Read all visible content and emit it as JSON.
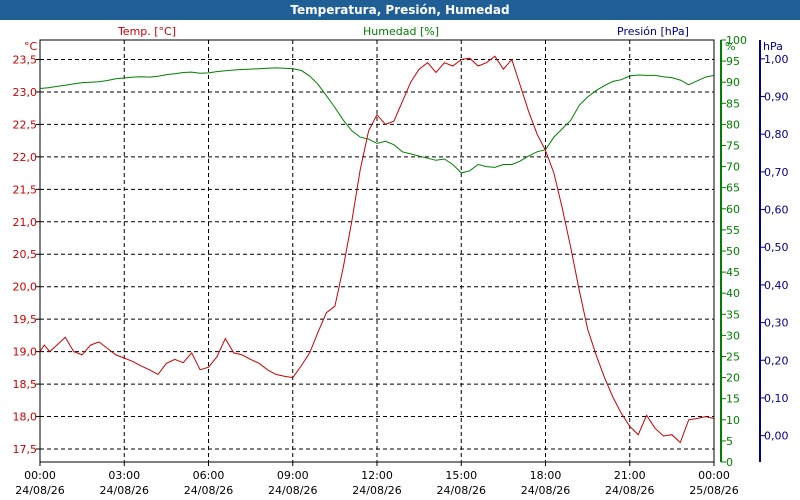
{
  "window": {
    "title": "Temperatura, Presión, Humedad"
  },
  "chart_data": {
    "type": "line",
    "title": "Temperatura, Presión, Humedad",
    "grid": true,
    "x_ticks": [
      {
        "time": "00:00",
        "date": "24/08/26"
      },
      {
        "time": "03:00",
        "date": "24/08/26"
      },
      {
        "time": "06:00",
        "date": "24/08/26"
      },
      {
        "time": "09:00",
        "date": "24/08/26"
      },
      {
        "time": "12:00",
        "date": "24/08/26"
      },
      {
        "time": "15:00",
        "date": "24/08/26"
      },
      {
        "time": "18:00",
        "date": "24/08/26"
      },
      {
        "time": "21:00",
        "date": "24/08/26"
      },
      {
        "time": "00:00",
        "date": "25/08/26"
      }
    ],
    "x_range_hours": [
      0,
      24
    ],
    "axes": {
      "temperature": {
        "label": "Temp. [°C]",
        "unit": "°C",
        "color": "#cc0000",
        "range": [
          17.3,
          23.8
        ],
        "ticks": [
          "17,5",
          "18,0",
          "18,5",
          "19,0",
          "19,5",
          "20,0",
          "20,5",
          "21,0",
          "21,5",
          "22,0",
          "22,5",
          "23,0",
          "23,5"
        ]
      },
      "humidity": {
        "label": "Humedad [%]",
        "unit": "%",
        "color": "#008000",
        "range": [
          0,
          100
        ],
        "ticks": [
          "0",
          "5",
          "10",
          "15",
          "20",
          "25",
          "30",
          "35",
          "40",
          "45",
          "50",
          "55",
          "60",
          "65",
          "70",
          "75",
          "80",
          "85",
          "90",
          "95",
          "100"
        ]
      },
      "pressure": {
        "label": "Presión [hPa]",
        "unit": "hPa",
        "color": "#00008b",
        "range": [
          -0.07,
          1.05
        ],
        "ticks": [
          "0,00",
          "0,10",
          "0,20",
          "0,30",
          "0,40",
          "0,50",
          "0,60",
          "0,70",
          "0,80",
          "0,90",
          "1,00"
        ]
      }
    },
    "series": [
      {
        "name": "Temp. [°C]",
        "axis": "temperature",
        "color": "#cc0000",
        "x": [
          0,
          0.15,
          0.35,
          0.6,
          0.9,
          1.2,
          1.5,
          1.8,
          2.1,
          2.4,
          2.7,
          3,
          3.3,
          3.6,
          3.9,
          4.2,
          4.5,
          4.8,
          5.1,
          5.4,
          5.7,
          6,
          6.3,
          6.6,
          6.9,
          7.2,
          7.5,
          7.8,
          8.1,
          8.4,
          8.7,
          9,
          9.3,
          9.6,
          9.9,
          10.2,
          10.5,
          10.8,
          11.1,
          11.4,
          11.7,
          12,
          12.3,
          12.6,
          12.9,
          13.2,
          13.5,
          13.8,
          14.1,
          14.4,
          14.7,
          15,
          15.3,
          15.6,
          15.9,
          16.2,
          16.5,
          16.8,
          17.1,
          17.4,
          17.7,
          18,
          18.3,
          18.6,
          18.9,
          19.2,
          19.5,
          19.8,
          20.1,
          20.4,
          20.7,
          21,
          21.3,
          21.6,
          21.9,
          22.2,
          22.5,
          22.8,
          23.1,
          23.4,
          23.7,
          24
        ],
        "values": [
          19.0,
          19.1,
          19.0,
          19.1,
          19.22,
          19.0,
          18.95,
          19.1,
          19.15,
          19.05,
          18.95,
          18.9,
          18.85,
          18.78,
          18.72,
          18.65,
          18.82,
          18.88,
          18.83,
          18.98,
          18.72,
          18.76,
          18.92,
          19.2,
          18.98,
          18.95,
          18.88,
          18.82,
          18.72,
          18.65,
          18.62,
          18.6,
          18.78,
          18.98,
          19.3,
          19.6,
          19.7,
          20.3,
          21.0,
          21.8,
          22.4,
          22.65,
          22.5,
          22.55,
          22.85,
          23.15,
          23.35,
          23.45,
          23.3,
          23.45,
          23.4,
          23.5,
          23.52,
          23.4,
          23.45,
          23.55,
          23.35,
          23.5,
          23.1,
          22.7,
          22.35,
          22.1,
          21.75,
          21.2,
          20.6,
          19.95,
          19.35,
          18.95,
          18.6,
          18.3,
          18.05,
          17.85,
          17.72,
          18.02,
          17.82,
          17.7,
          17.72,
          17.6,
          17.95,
          17.97,
          18.0,
          17.97
        ]
      },
      {
        "name": "Humedad [%]",
        "axis": "humidity",
        "color": "#008000",
        "x": [
          0,
          0.3,
          0.6,
          0.9,
          1.2,
          1.5,
          1.8,
          2.1,
          2.4,
          2.7,
          3,
          3.3,
          3.6,
          3.9,
          4.2,
          4.5,
          4.8,
          5.1,
          5.4,
          5.7,
          6,
          6.3,
          6.6,
          6.9,
          7.2,
          7.5,
          7.8,
          8.1,
          8.4,
          8.7,
          9,
          9.3,
          9.6,
          9.9,
          10.2,
          10.5,
          10.8,
          11.1,
          11.4,
          11.7,
          12,
          12.3,
          12.6,
          12.9,
          13.2,
          13.5,
          13.8,
          14.1,
          14.4,
          14.7,
          15,
          15.3,
          15.6,
          15.9,
          16.2,
          16.5,
          16.8,
          17.1,
          17.4,
          17.7,
          18,
          18.3,
          18.6,
          18.9,
          19.2,
          19.5,
          19.8,
          20.1,
          20.4,
          20.7,
          21,
          21.3,
          21.6,
          21.9,
          22.2,
          22.5,
          22.8,
          23.1,
          23.4,
          23.7,
          24
        ],
        "values": [
          88.5,
          88.7,
          89,
          89.3,
          89.6,
          89.9,
          90,
          90.1,
          90.4,
          90.8,
          91,
          91.2,
          91.3,
          91.2,
          91.4,
          91.8,
          92,
          92.3,
          92.4,
          92.1,
          92.2,
          92.5,
          92.7,
          92.9,
          93,
          93.1,
          93.2,
          93.3,
          93.4,
          93.3,
          93.2,
          92.8,
          91.5,
          89.5,
          86.8,
          84,
          81,
          78.5,
          77,
          76.5,
          75.5,
          76,
          75.2,
          73.5,
          73,
          72.5,
          72,
          71.5,
          71.8,
          70.5,
          68.5,
          69,
          70.5,
          70,
          69.8,
          70.5,
          70.5,
          71.3,
          72.5,
          73.5,
          74,
          77,
          79,
          81,
          84.5,
          86.5,
          88,
          89.2,
          90.2,
          90.6,
          91.5,
          91.7,
          91.6,
          91.6,
          91.3,
          91.1,
          90.5,
          89.4,
          90.3,
          91.2,
          91.6
        ]
      }
    ]
  }
}
